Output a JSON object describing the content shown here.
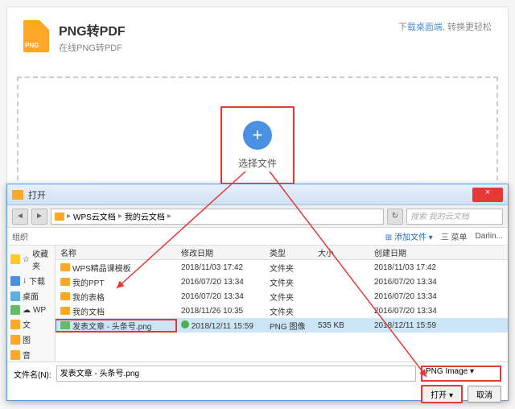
{
  "header": {
    "title": "PNG转PDF",
    "subtitle": "在线PNG转PDF",
    "icon_label": "PNG",
    "right_prefix": "下",
    "right_link": "载桌面端",
    "right_suffix": ", 转换更轻松"
  },
  "dropzone": {
    "button_label": "选择文件"
  },
  "dialog": {
    "title": "打开",
    "close": "×",
    "breadcrumb": [
      "WPS云文档",
      "我的云文档"
    ],
    "search_placeholder": "搜索 我的云文档",
    "toolbar": {
      "organize": "组织",
      "addfile": "添加文件",
      "list": "三 菜单",
      "user": "Darlin..."
    },
    "sidebar": [
      {
        "label": "收藏夹",
        "type": "star"
      },
      {
        "label": "下载",
        "type": "dl"
      },
      {
        "label": "桌面",
        "type": "desk"
      },
      {
        "label": "WP",
        "type": "cloud"
      },
      {
        "label": "文",
        "type": "folder"
      },
      {
        "label": "图",
        "type": "folder"
      },
      {
        "label": "音",
        "type": "folder"
      }
    ],
    "columns": {
      "name": "名称",
      "date": "修改日期",
      "type": "类型",
      "size": "大小",
      "cdate": "创建日期"
    },
    "rows": [
      {
        "name": "WPS精品课模板",
        "date": "2018/11/03 17:42",
        "type": "文件夹",
        "size": "",
        "cdate": "2018/11/03 17:42",
        "icon": "folder"
      },
      {
        "name": "我的PPT",
        "date": "2016/07/20 13:34",
        "type": "文件夹",
        "size": "",
        "cdate": "2016/07/20 13:34",
        "icon": "folder"
      },
      {
        "name": "我的表格",
        "date": "2016/07/20 13:34",
        "type": "文件夹",
        "size": "",
        "cdate": "2016/07/20 13:34",
        "icon": "folder"
      },
      {
        "name": "我的文档",
        "date": "2018/11/26 10:35",
        "type": "文件夹",
        "size": "",
        "cdate": "2016/07/20 13:34",
        "icon": "folder"
      },
      {
        "name": "发表文章 - 头条号.png",
        "date": "2018/12/11 15:59",
        "type": "PNG 图像",
        "size": "535 KB",
        "cdate": "2018/12/11 15:59",
        "icon": "png",
        "selected": true,
        "synced": true
      }
    ],
    "footer": {
      "label": "文件名(N):",
      "value": "发表文章 - 头条号.png",
      "filter": "PNG Image",
      "open": "打开",
      "cancel": "取消"
    }
  }
}
